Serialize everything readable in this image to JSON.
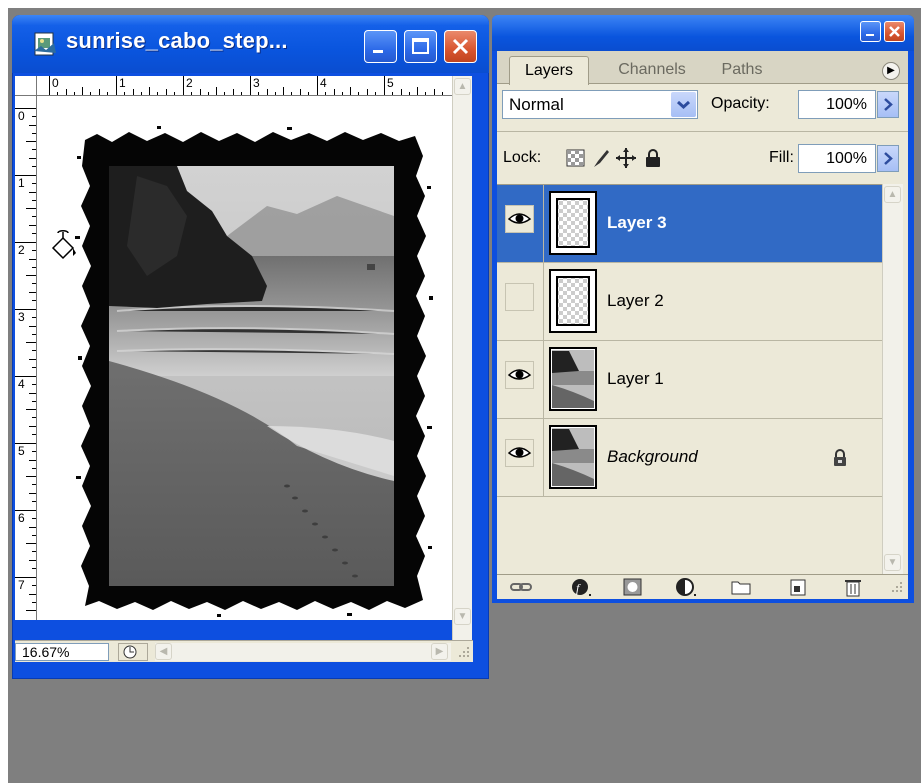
{
  "document_window": {
    "title": "sunrise_cabo_step...",
    "ruler_top_ticks": [
      "0",
      "1",
      "2",
      "3",
      "4",
      "5"
    ],
    "ruler_left_ticks": [
      "0",
      "1",
      "2",
      "3",
      "4",
      "5",
      "6",
      "7"
    ],
    "zoom": "16.67%",
    "icons": [
      "document-icon",
      "minimize-icon",
      "maximize-icon",
      "close-icon",
      "scroll-up-arrow-icon",
      "scroll-down-arrow-icon",
      "scroll-left-arrow-icon",
      "scroll-right-arrow-icon",
      "status-menu-icon",
      "paint-bucket-cursor-icon",
      "resize-grip-icon"
    ]
  },
  "layers_panel": {
    "tabs": [
      "Layers",
      "Channels",
      "Paths"
    ],
    "active_tab": "Layers",
    "blend_mode": "Normal",
    "opacity_label": "Opacity:",
    "opacity": "100%",
    "lock_label": "Lock:",
    "fill_label": "Fill:",
    "fill": "100%",
    "layers": [
      {
        "name": "Layer 3",
        "visible": true,
        "selected": true
      },
      {
        "name": "Layer 2",
        "visible": false,
        "selected": false
      },
      {
        "name": "Layer 1",
        "visible": true,
        "selected": false
      },
      {
        "name": "Background",
        "visible": true,
        "selected": false,
        "locked": true
      }
    ],
    "footer_icons": [
      "link-layers-icon",
      "layer-style-icon",
      "add-mask-icon",
      "adjustment-layer-icon",
      "new-group-icon",
      "new-layer-icon",
      "delete-layer-icon"
    ]
  },
  "colors": {
    "titlebar": "#0a55de",
    "selection": "#316ac5",
    "panel_bg": "#ece9d8",
    "desktop": "#7f7f7f"
  }
}
